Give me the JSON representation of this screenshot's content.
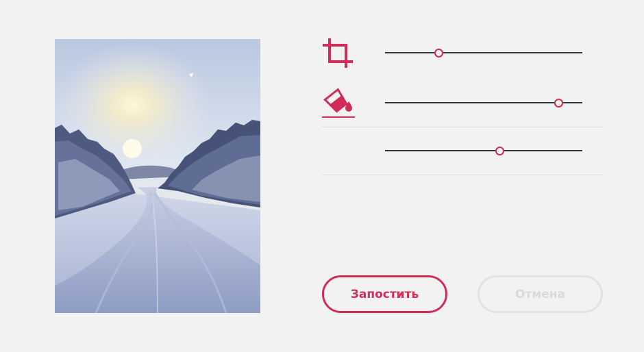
{
  "photo": {
    "subject": "snowy-road-winter-forest-sunrise"
  },
  "tools": {
    "crop_icon": "crop-icon",
    "fill_icon": "paint-bucket-icon",
    "accent_color": "#cf2d57",
    "track_color": "#2c3340"
  },
  "sliders": [
    {
      "name": "crop-slider",
      "value": 0.27
    },
    {
      "name": "fill-slider",
      "value": 0.88
    },
    {
      "name": "third-slider",
      "value": 0.58
    }
  ],
  "actions": {
    "post_label": "Запостить",
    "cancel_label": "Отмена"
  }
}
